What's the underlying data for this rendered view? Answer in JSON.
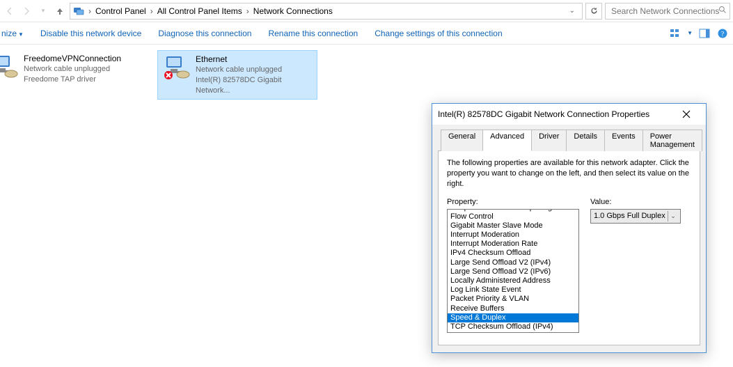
{
  "breadcrumb": {
    "items": [
      "Control Panel",
      "All Control Panel Items",
      "Network Connections"
    ]
  },
  "search": {
    "placeholder": "Search Network Connections"
  },
  "toolbar": {
    "organize": "nize",
    "disable": "Disable this network device",
    "diagnose": "Diagnose this connection",
    "rename": "Rename this connection",
    "change": "Change settings of this connection"
  },
  "connections": [
    {
      "title": "FreedomeVPNConnection",
      "status": "Network cable unplugged",
      "detail": "Freedome TAP driver",
      "selected": false
    },
    {
      "title": "Ethernet",
      "status": "Network cable unplugged",
      "detail": "Intel(R) 82578DC Gigabit Network...",
      "selected": true
    }
  ],
  "dialog": {
    "title": "Intel(R) 82578DC Gigabit Network Connection Properties",
    "tabs": [
      "General",
      "Advanced",
      "Driver",
      "Details",
      "Events",
      "Power Management"
    ],
    "active_tab": "Advanced",
    "description": "The following properties are available for this network adapter. Click the property you want to change on the left, and then select its value on the right.",
    "property_label": "Property:",
    "value_label": "Value:",
    "properties": [
      "Adaptive Inter-Frame Spacing",
      "Flow Control",
      "Gigabit Master Slave Mode",
      "Interrupt Moderation",
      "Interrupt Moderation Rate",
      "IPv4 Checksum Offload",
      "Large Send Offload V2 (IPv4)",
      "Large Send Offload V2 (IPv6)",
      "Locally Administered Address",
      "Log Link State Event",
      "Packet Priority & VLAN",
      "Receive Buffers",
      "Speed & Duplex",
      "TCP Checksum Offload (IPv4)"
    ],
    "selected_property": "Speed & Duplex",
    "value": "1.0 Gbps Full Duplex"
  }
}
